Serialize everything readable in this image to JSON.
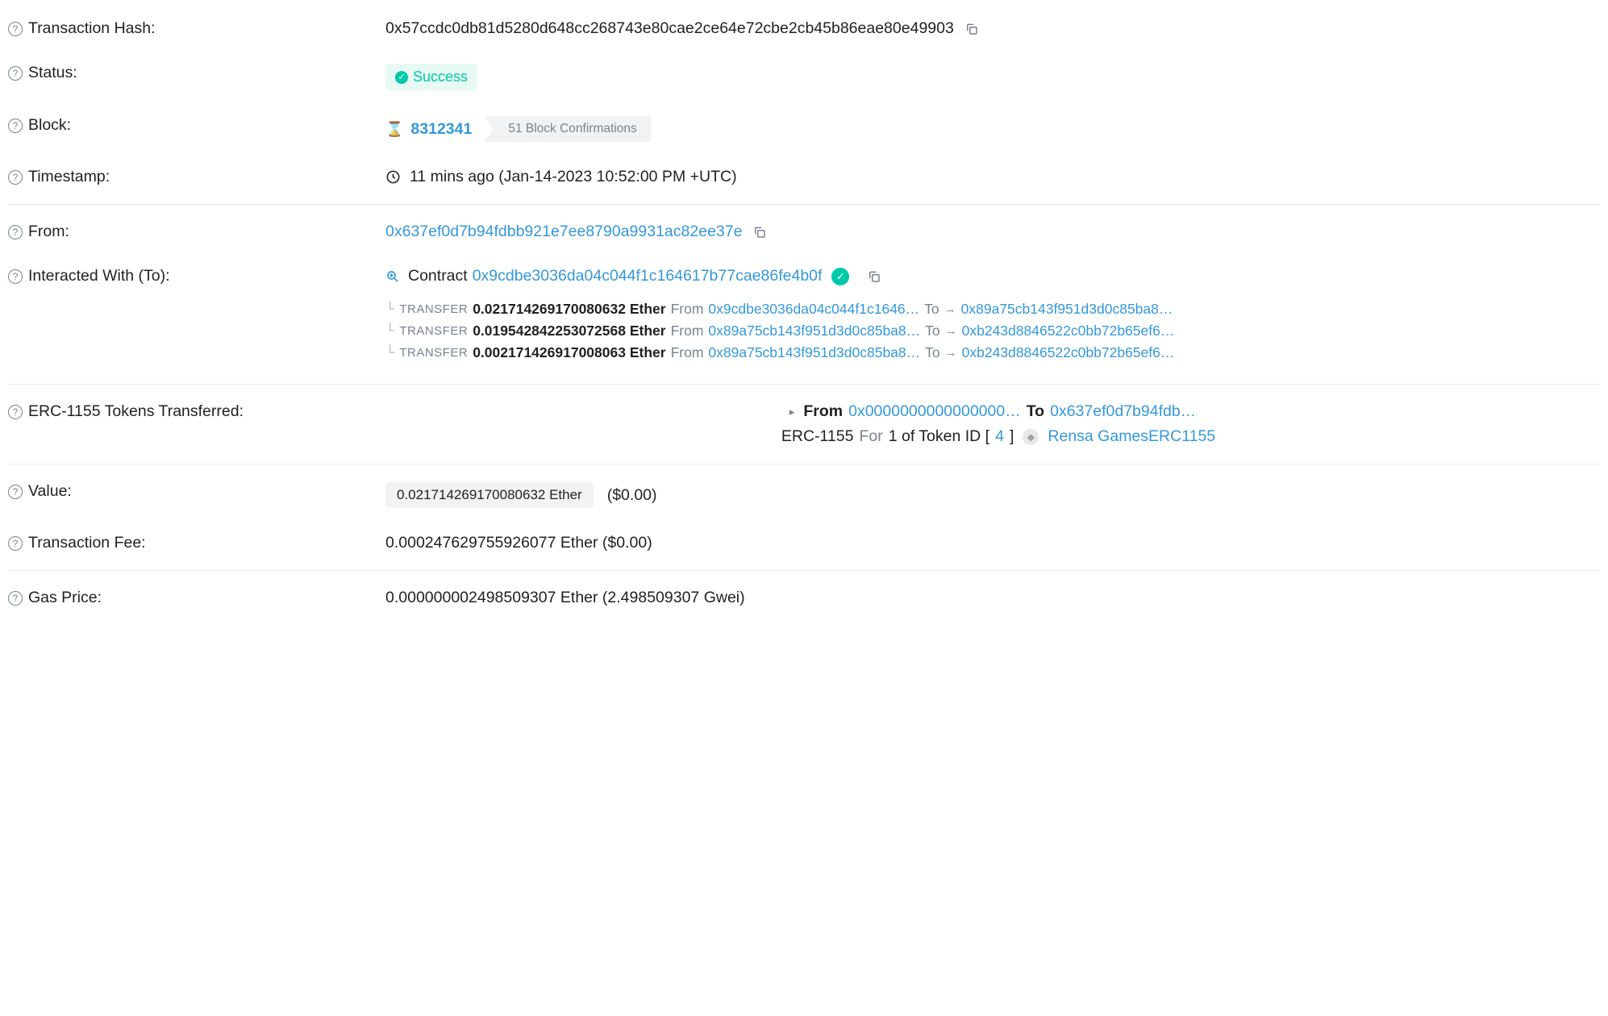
{
  "labels": {
    "txhash": "Transaction Hash:",
    "status": "Status:",
    "block": "Block:",
    "timestamp": "Timestamp:",
    "from": "From:",
    "to": "Interacted With (To):",
    "erc1155": "ERC-1155 Tokens Transferred:",
    "value": "Value:",
    "txfee": "Transaction Fee:",
    "gasprice": "Gas Price:"
  },
  "txhash": "0x57ccdc0db81d5280d648cc268743e80cae2ce64e72cbe2cb45b86eae80e49903",
  "status": "Success",
  "block": {
    "number": "8312341",
    "confirmations": "51 Block Confirmations"
  },
  "timestamp": "11 mins ago (Jan-14-2023 10:52:00 PM +UTC)",
  "from": "0x637ef0d7b94fdbb921e7ee8790a9931ac82ee37e",
  "to": {
    "prefix": "Contract",
    "address": "0x9cdbe3036da04c044f1c164617b77cae86fe4b0f"
  },
  "transfers": [
    {
      "label": "TRANSFER",
      "amount": "0.021714269170080632 Ether",
      "from_word": "From",
      "from": "0x9cdbe3036da04c044f1c1646…",
      "to_word": "To",
      "to": "0x89a75cb143f951d3d0c85ba8…"
    },
    {
      "label": "TRANSFER",
      "amount": "0.019542842253072568 Ether",
      "from_word": "From",
      "from": "0x89a75cb143f951d3d0c85ba8…",
      "to_word": "To",
      "to": "0xb243d8846522c0bb72b65ef6…"
    },
    {
      "label": "TRANSFER",
      "amount": "0.002171426917008063 Ether",
      "from_word": "From",
      "from": "0x89a75cb143f951d3d0c85ba8…",
      "to_word": "To",
      "to": "0xb243d8846522c0bb72b65ef6…"
    }
  ],
  "erc1155": {
    "from_label": "From",
    "from": "0x0000000000000000…",
    "to_label": "To",
    "to": "0x637ef0d7b94fdb…",
    "line2_prefix": "ERC-1155",
    "line2_for": "For",
    "line2_qty": "1 of Token ID [",
    "token_id": "4",
    "line2_close": "]",
    "token_name": "Rensa GamesERC1155"
  },
  "value": {
    "pill": "0.021714269170080632 Ether",
    "usd": "($0.00)"
  },
  "txfee": "0.000247629755926077 Ether ($0.00)",
  "gasprice": "0.000000002498509307 Ether (2.498509307 Gwei)"
}
